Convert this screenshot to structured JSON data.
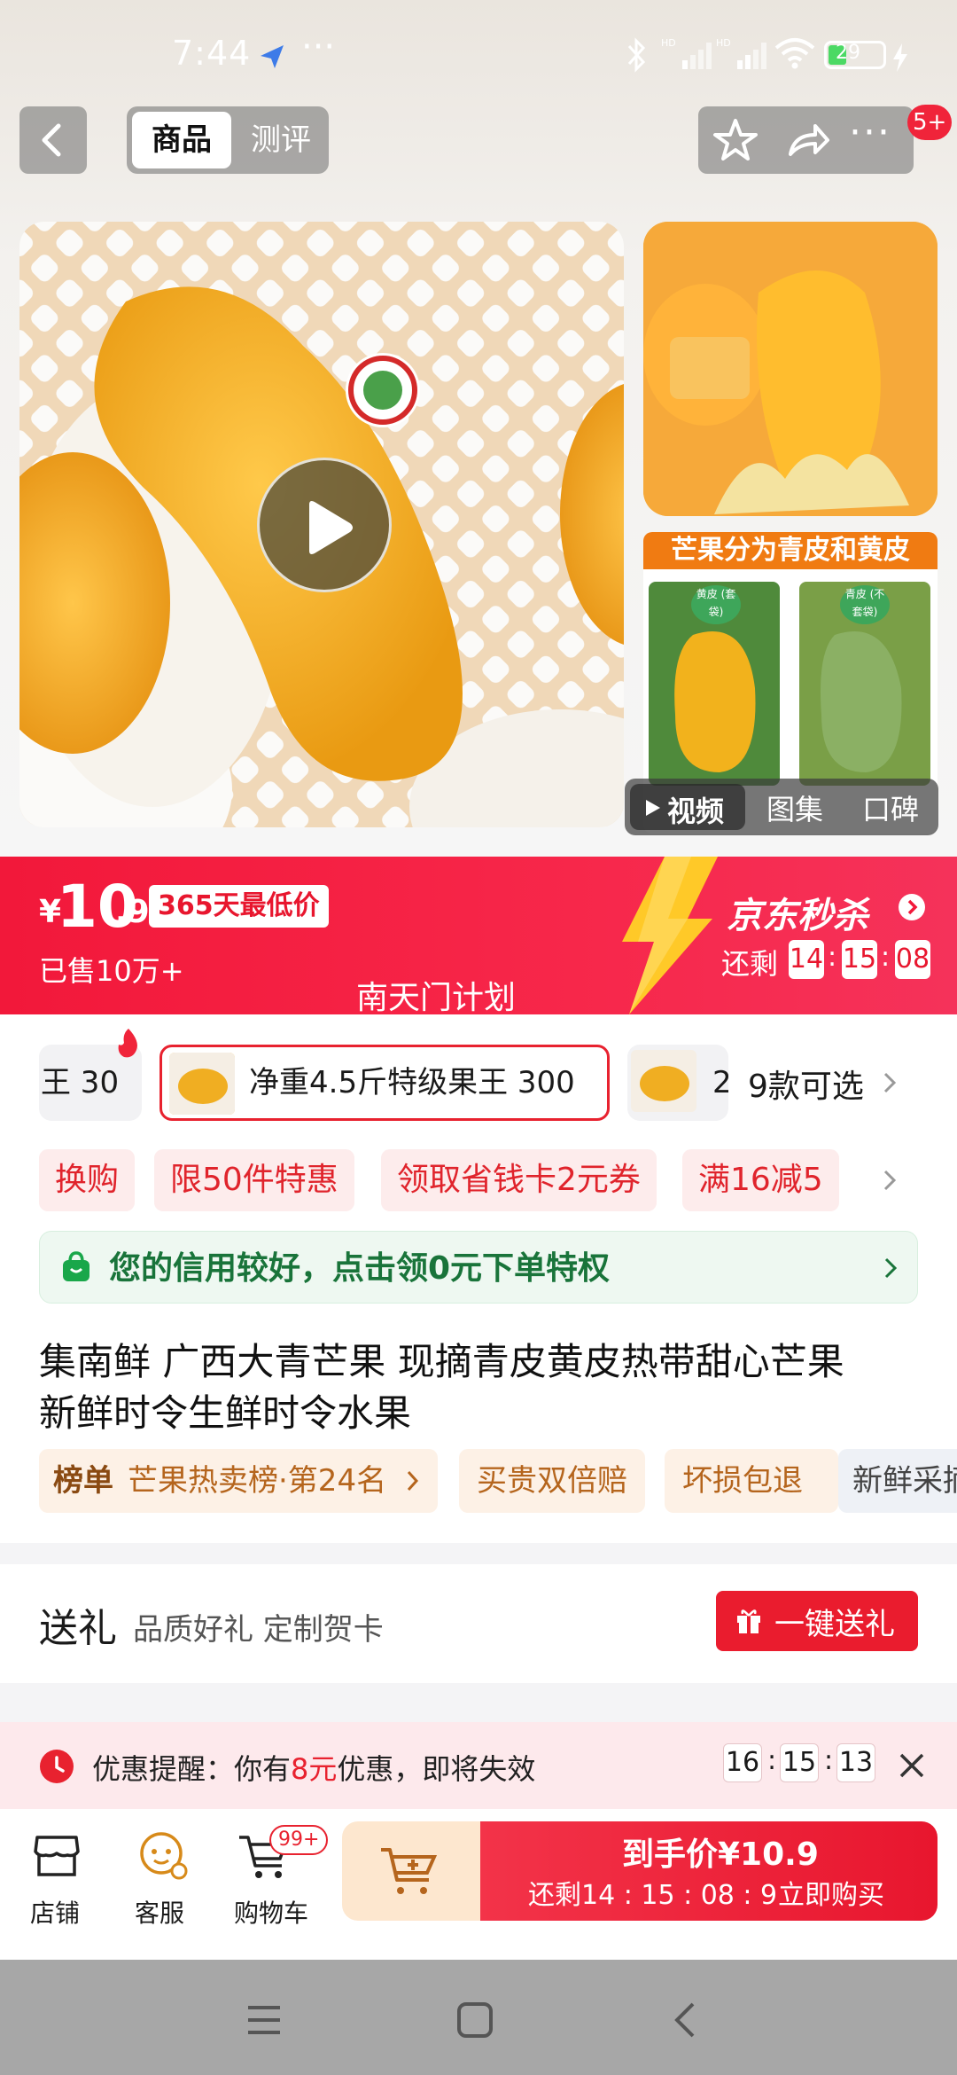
{
  "status_bar": {
    "time": "7:44",
    "dots": "···",
    "battery": "29"
  },
  "header": {
    "tab_product": "商品",
    "tab_review": "测评",
    "more_dots": "···",
    "badge": "5+"
  },
  "gallery": {
    "side_banner": "芒果分为青皮和黄皮",
    "left_tag": "黄皮 (套袋)",
    "right_tag": "青皮 (不套袋)",
    "media_tabs": [
      "视频",
      "图集",
      "口碑"
    ]
  },
  "promo": {
    "currency": "¥",
    "price_int": "10",
    "price_dec": ".9",
    "lowest_badge": "365天最低价",
    "sold": "已售10万+",
    "flash_brand": "京东秒杀",
    "remaining_label": "还剩",
    "countdown": [
      "14",
      "15",
      "08"
    ],
    "plan_text": "南天门计划"
  },
  "variants": {
    "chip1": "王 30",
    "chip2": "净重4.5斤特级果王  300",
    "chip3": "2",
    "count": "9款可选"
  },
  "tags": [
    "换购",
    "限50件特惠",
    "领取省钱卡2元券",
    "满16减5"
  ],
  "credit": {
    "text": "您的信用较好，点击领0元下单特权"
  },
  "title": {
    "line1": "集南鲜 广西大青芒果 现摘青皮黄皮热带甜心芒果",
    "line2": "新鲜时令生鲜时令水果"
  },
  "rank": {
    "label": "榜单",
    "value": "芒果热卖榜·第24名",
    "badge2": "买贵双倍赔",
    "badge3": "坏损包退",
    "badge4": "新鲜采摘"
  },
  "gift": {
    "title": "送礼",
    "subtitle": "品质好礼 定制贺卡",
    "button": "一键送礼"
  },
  "reminder": {
    "prefix": "优惠提醒：你有",
    "amount": "8元",
    "suffix": "优惠，即将失效",
    "countdown": [
      "16",
      "15",
      "13"
    ]
  },
  "bottom": {
    "shop": "店铺",
    "service": "客服",
    "cart": "购物车",
    "cart_badge": "99+",
    "buy_price": "到手价¥10.9",
    "buy_remaining": "还剩14 : 15 : 08 : 9",
    "buy_now": "立即购买"
  },
  "colors": {
    "accent": "#f2183a",
    "credit_green": "#19a74a",
    "rank_brown": "#b5651d"
  }
}
